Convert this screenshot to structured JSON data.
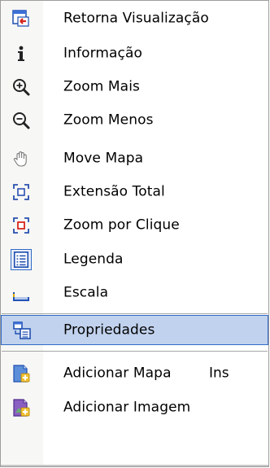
{
  "menu": {
    "items": [
      {
        "label": "Retorna Visualização",
        "icon": "return-view-icon"
      },
      {
        "label": "Informação",
        "icon": "info-icon"
      },
      {
        "label": "Zoom Mais",
        "icon": "zoom-in-icon"
      },
      {
        "label": "Zoom Menos",
        "icon": "zoom-out-icon"
      },
      {
        "label": "Move Mapa",
        "icon": "pan-hand-icon"
      },
      {
        "label": "Extensão Total",
        "icon": "full-extent-icon"
      },
      {
        "label": "Zoom por Clique",
        "icon": "zoom-click-icon"
      },
      {
        "label": "Legenda",
        "icon": "legend-icon",
        "checked": true
      },
      {
        "label": "Escala",
        "icon": "scale-icon"
      },
      {
        "label": "Propriedades",
        "icon": "properties-icon",
        "selected": true
      },
      {
        "label": "Adicionar Mapa",
        "icon": "add-map-icon",
        "shortcut": "Ins"
      },
      {
        "label": "Adicionar Imagem",
        "icon": "add-image-icon"
      }
    ]
  },
  "colors": {
    "selection_bg": "#c1d2ee",
    "selection_border": "#316ac5",
    "gutter_bg": "#f7f7f5"
  }
}
